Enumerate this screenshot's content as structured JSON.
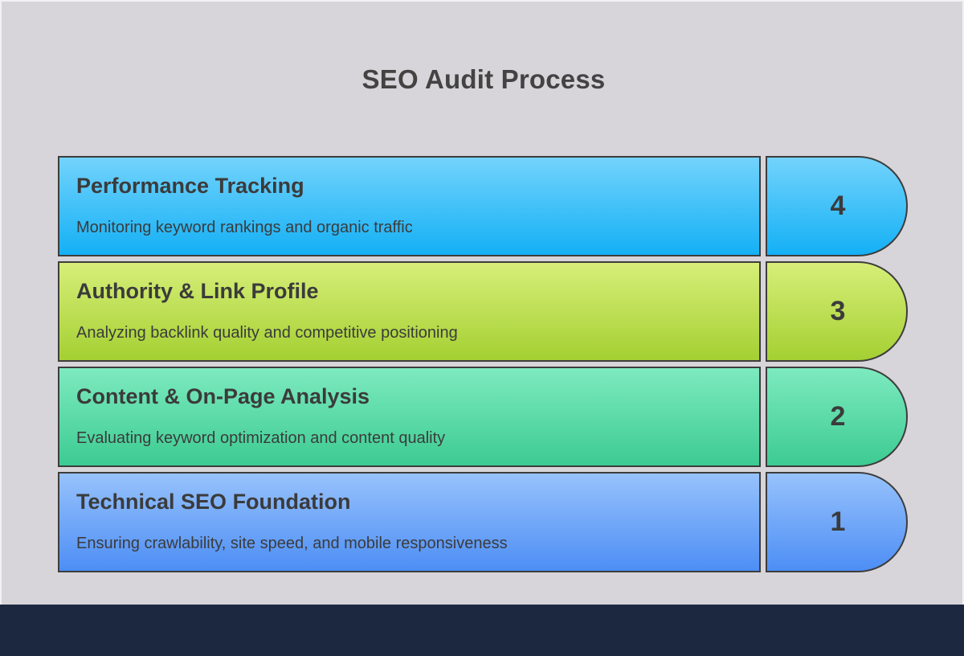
{
  "title": "SEO Audit Process",
  "layers": [
    {
      "number": "4",
      "title": "Performance Tracking",
      "description": "Monitoring keyword rankings and organic traffic",
      "color_top": "#73d3fc",
      "color_bottom": "#14b0f5"
    },
    {
      "number": "3",
      "title": "Authority & Link Profile",
      "description": "Analyzing backlink quality and competitive positioning",
      "color_top": "#d7ee79",
      "color_bottom": "#a4d032"
    },
    {
      "number": "2",
      "title": "Content & On-Page Analysis",
      "description": "Evaluating keyword optimization and content quality",
      "color_top": "#7deabf",
      "color_bottom": "#3dcb92"
    },
    {
      "number": "1",
      "title": "Technical SEO Foundation",
      "description": "Ensuring crawlability, site speed, and mobile responsiveness",
      "color_top": "#97c2fc",
      "color_bottom": "#4d8ef5"
    }
  ],
  "colors": {
    "background": "#d7d5d9",
    "footer": "#1b2840",
    "text": "#3b3b3b",
    "border": "#3d3d3d"
  }
}
